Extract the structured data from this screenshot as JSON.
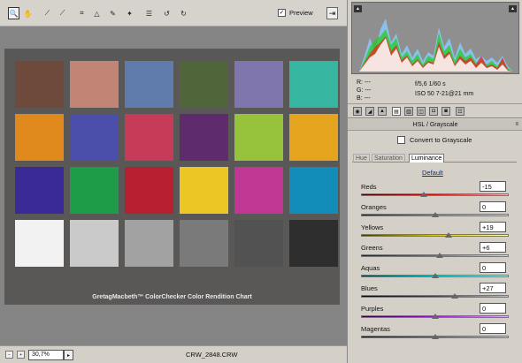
{
  "toolbar": {
    "tools": [
      {
        "name": "zoom-tool",
        "icon": "magnifier-icon",
        "glyph": "🔍",
        "active": true
      },
      {
        "name": "hand-tool",
        "icon": "hand-icon",
        "glyph": "✋",
        "active": false
      },
      {
        "name": "white-balance-tool",
        "icon": "eyedropper-icon",
        "glyph": "⟋",
        "active": false
      },
      {
        "name": "color-sampler-tool",
        "icon": "sampler-icon",
        "glyph": "⟋",
        "active": false
      },
      {
        "name": "crop-tool",
        "icon": "crop-icon",
        "glyph": "⌗",
        "active": false
      },
      {
        "name": "straighten-tool",
        "icon": "straighten-icon",
        "glyph": "△",
        "active": false
      },
      {
        "name": "retouch-tool",
        "icon": "retouch-icon",
        "glyph": "✎",
        "active": false
      },
      {
        "name": "red-eye-tool",
        "icon": "red-eye-icon",
        "glyph": "✦",
        "active": false
      },
      {
        "name": "preferences-tool",
        "icon": "list-icon",
        "glyph": "☰",
        "active": false
      },
      {
        "name": "rotate-left-tool",
        "icon": "rotate-left-icon",
        "glyph": "↺",
        "active": false
      },
      {
        "name": "rotate-right-tool",
        "icon": "rotate-right-icon",
        "glyph": "↻",
        "active": false
      }
    ],
    "preview_label": "Preview",
    "preview_checked": "✓"
  },
  "image": {
    "chart_caption": "GretagMacbeth™ ColorChecker Color Rendition Chart",
    "swatch_colors": [
      "#6e4a3c",
      "#c28474",
      "#5f7cac",
      "#50663a",
      "#8076ae",
      "#36b6a0",
      "#e08a1e",
      "#4a4ea8",
      "#c63c58",
      "#5e2c6c",
      "#96c23c",
      "#e4a41e",
      "#3a2a98",
      "#1e9c48",
      "#b82032",
      "#ecc624",
      "#c03894",
      "#128cb8",
      "#f2f2f2",
      "#cacaca",
      "#a2a2a2",
      "#7a7a7a",
      "#525252",
      "#2e2e2e"
    ]
  },
  "statusbar": {
    "zoom_value": "30,7%",
    "filename": "CRW_2848.CRW"
  },
  "readout": {
    "r_label": "R:",
    "r_value": "---",
    "g_label": "G:",
    "g_value": "---",
    "b_label": "B:",
    "b_value": "---",
    "aperture_shutter": "f/5,6   1/60 s",
    "iso_lens": "ISO 50   7-21@21 mm"
  },
  "panel": {
    "section_title": "HSL / Grayscale",
    "convert_label": "Convert to Grayscale",
    "subtabs": [
      "Hue",
      "Saturation",
      "Luminance"
    ],
    "active_subtab": "Luminance",
    "default_link": "Default",
    "sliders": [
      {
        "label": "Reds",
        "value": "-15",
        "level": -15,
        "gradient": "linear-gradient(to right,#3a0000,#d81010,#ffb0b0)"
      },
      {
        "label": "Oranges",
        "value": "0",
        "level": 0,
        "gradient": "linear-gradient(to right,#3a1a00,#e07010,#ffd0a0)"
      },
      {
        "label": "Yellows",
        "value": "+19",
        "level": 19,
        "gradient": "linear-gradient(to right,#3a3a00,#d8c810,#ffffb0)"
      },
      {
        "label": "Greens",
        "value": "+6",
        "level": 6,
        "gradient": "linear-gradient(to right,#003a00,#18b018,#b0ffb0)"
      },
      {
        "label": "Aquas",
        "value": "0",
        "level": 0,
        "gradient": "linear-gradient(to right,#003a3a,#10c8c8,#b0ffff)"
      },
      {
        "label": "Blues",
        "value": "+27",
        "level": 27,
        "gradient": "linear-gradient(to right,#00003a,#1838d8,#b0c0ff)"
      },
      {
        "label": "Purples",
        "value": "0",
        "level": 0,
        "gradient": "linear-gradient(to right,#2a003a,#9018d0,#e0b0ff)"
      },
      {
        "label": "Magentas",
        "value": "0",
        "level": 0,
        "gradient": "linear-gradient(to right,#3a002a,#d818a8,#ffb0e8)"
      }
    ]
  }
}
